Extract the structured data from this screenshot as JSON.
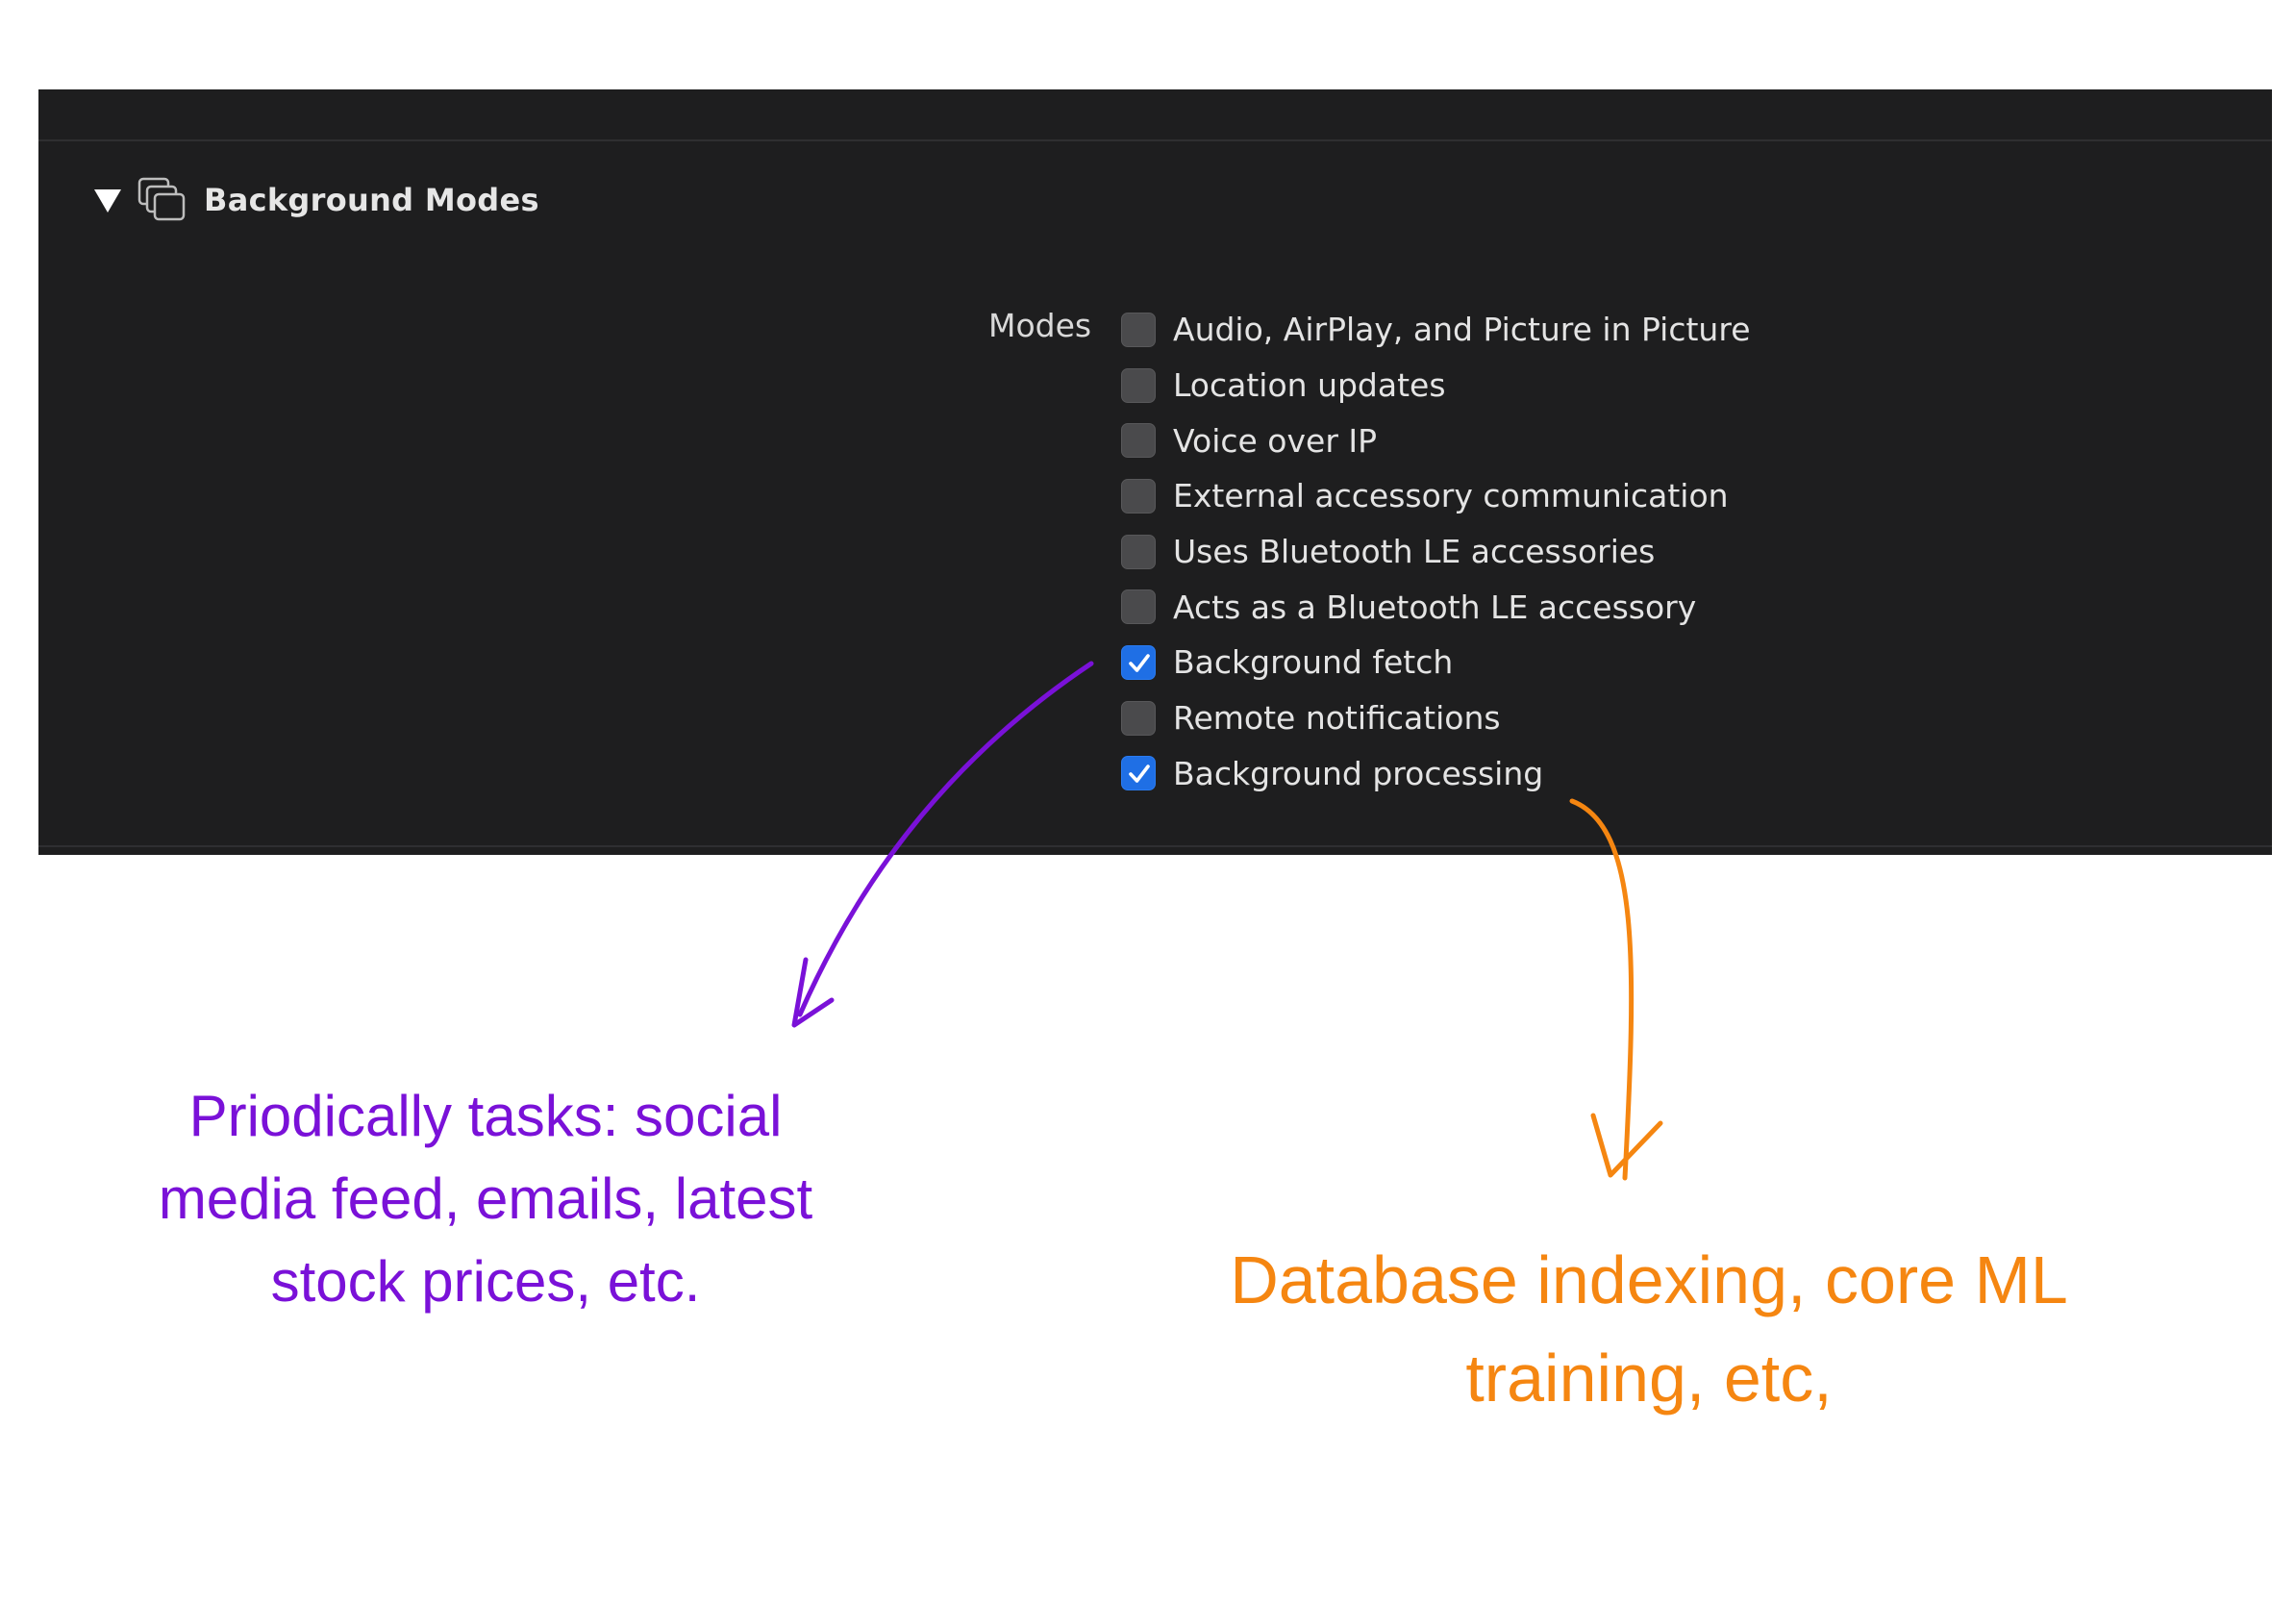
{
  "section": {
    "title": "Background Modes",
    "icon": "layered-windows-icon"
  },
  "modes": {
    "label": "Modes",
    "items": [
      {
        "label": "Audio, AirPlay, and Picture in Picture",
        "checked": false
      },
      {
        "label": "Location updates",
        "checked": false
      },
      {
        "label": "Voice over IP",
        "checked": false
      },
      {
        "label": "External accessory communication",
        "checked": false
      },
      {
        "label": "Uses Bluetooth LE accessories",
        "checked": false
      },
      {
        "label": "Acts as a Bluetooth LE accessory",
        "checked": false
      },
      {
        "label": "Background fetch",
        "checked": true
      },
      {
        "label": "Remote notifications",
        "checked": false
      },
      {
        "label": "Background processing",
        "checked": true
      }
    ]
  },
  "annotations": {
    "fetch_note": {
      "line1": "Priodically tasks: social",
      "line2": "media feed, emails, latest",
      "line3": "stock prices, etc."
    },
    "processing_note": {
      "line1": "Database indexing, core ML",
      "line2": "training, etc,"
    }
  },
  "colors": {
    "panel_background": "#1e1e1f",
    "checkbox_checked": "#1f6fe5",
    "annotation_purple": "#7a11d8",
    "annotation_orange": "#f58611"
  }
}
